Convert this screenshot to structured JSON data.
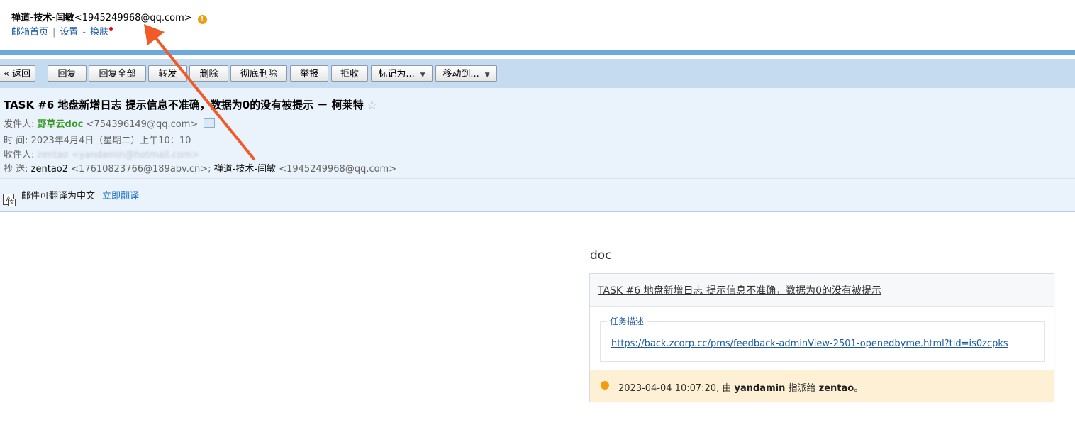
{
  "header": {
    "account_name": "禅道-技术-闫敏",
    "account_email": "<1945249968@qq.com>",
    "links": [
      "邮箱首页",
      "设置",
      "换肤"
    ],
    "link_separators": [
      "|",
      "-"
    ]
  },
  "toolbar": {
    "back": "« 返回",
    "reply": "回复",
    "reply_all": "回复全部",
    "forward": "转发",
    "delete": "删除",
    "delete_permanent": "彻底删除",
    "report": "举报",
    "reject": "拒收",
    "mark_as": "标记为...",
    "move_to": "移动到..."
  },
  "mail": {
    "subject": "TASK  #6  地盘新增日志  提示信息不准确，数据为0的没有被提示 － 柯莱特",
    "sender_label": "发件人:",
    "sender_name": "野草云doc",
    "sender_email": "<754396149@qq.com>",
    "time_label": "时    间:",
    "time_value": "2023年4月4日（星期二）上午10：10",
    "to_label": "收件人:",
    "to_value": "zentao <yandamin@hotmail.com>",
    "cc_label": "抄    送:",
    "cc1_name": "zentao2",
    "cc1_email": "<17610823766@189abv.cn>;",
    "cc2_name": "禅道-技术-闫敏",
    "cc2_email": "<1945249968@qq.com>",
    "translate_text": "邮件可翻译为中文",
    "translate_link": "立即翻译"
  },
  "body": {
    "doc_title": "doc",
    "task_link": "TASK  #6  地盘新增日志  提示信息不准确，数据为0的没有被提示",
    "fieldset_legend": "任务描述",
    "url": "https://back.zcorp.cc/pms/feedback-adminView-2501-openedbyme.html?tid=is0zcpks",
    "history_date": "2023-04-04 10:07:20,",
    "history_by": "由",
    "history_user": "yandamin",
    "history_action": "指派给",
    "history_target": "zentao",
    "history_end": "。"
  },
  "colors": {
    "accent_blue": "#6ea9dd",
    "toolbar_bg": "#c5dcf0",
    "meta_bg": "#eaf2fb",
    "sender_green": "#3a9a2a",
    "annotation_arrow": "#f25a28",
    "history_bg": "#fdf0d5"
  },
  "icons": [
    "warning-icon",
    "star-icon",
    "contact-card-icon",
    "translate-icon",
    "chevron-down-icon",
    "annotation-arrow"
  ]
}
